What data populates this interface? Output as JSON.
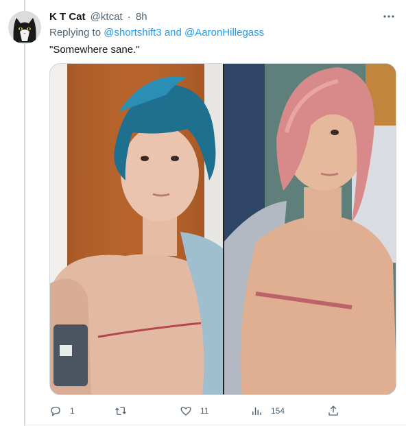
{
  "tweet": {
    "display_name": "K T Cat",
    "handle": "@ktcat",
    "separator": "·",
    "time": "8h",
    "replying_prefix": "Replying to",
    "mention_1": "@shortshift3",
    "conjunction": "and",
    "mention_2": "@AaronHillegass",
    "text": "\"Somewhere sane.\"",
    "more_icon": "more-horizontal-icon"
  },
  "actions": {
    "reply_count": "1",
    "retweet_count": "",
    "like_count": "11",
    "views_count": "154"
  },
  "colors": {
    "accent": "#1d9bf0",
    "secondary_text": "#536471",
    "primary_text": "#0f1419"
  }
}
